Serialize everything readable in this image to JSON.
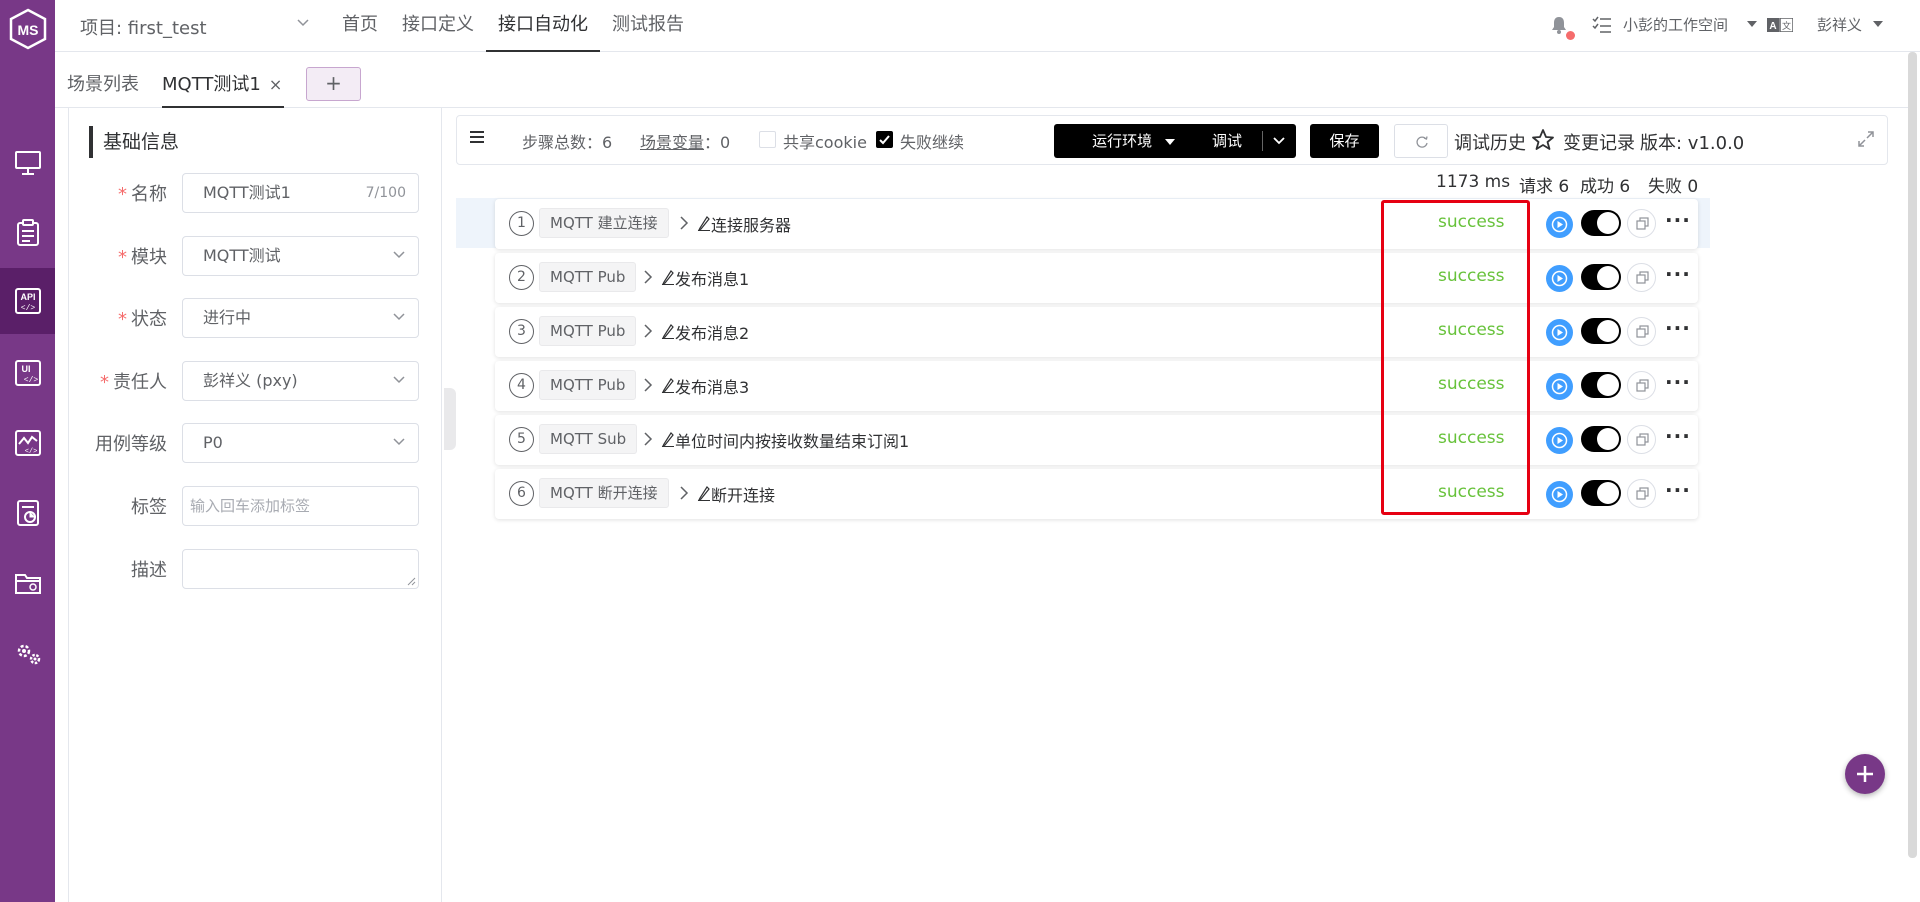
{
  "rail": {
    "logo_text": "MS",
    "items": [
      {
        "name": "workbench-icon",
        "active": false
      },
      {
        "name": "track-icon",
        "active": false
      },
      {
        "name": "api-icon",
        "active": true
      },
      {
        "name": "ui-icon",
        "active": false
      },
      {
        "name": "performance-icon",
        "active": false
      },
      {
        "name": "report-icon",
        "active": false
      },
      {
        "name": "project-icon",
        "active": false
      },
      {
        "name": "settings-icon",
        "active": false
      }
    ]
  },
  "header": {
    "project": "项目: first_test",
    "nav": [
      {
        "label": "首页",
        "active": false
      },
      {
        "label": "接口定义",
        "active": false
      },
      {
        "label": "接口自动化",
        "active": true
      },
      {
        "label": "测试报告",
        "active": false
      }
    ],
    "workspace": "小彭的工作空间",
    "user": "彭祥义"
  },
  "tabs": {
    "list_label": "场景列表",
    "active_label": "MQTT测试1",
    "close": "×",
    "add": "+"
  },
  "form": {
    "section_title": "基础信息",
    "required_mark": "*",
    "name_label": "名称",
    "name_value": "MQTT测试1",
    "name_count": "7/100",
    "module_label": "模块",
    "module_value": "MQTT测试",
    "status_label": "状态",
    "status_value": "进行中",
    "owner_label": "责任人",
    "owner_value": "彭祥义 (pxy)",
    "level_label": "用例等级",
    "level_value": "P0",
    "tags_label": "标签",
    "tags_placeholder": "输入回车添加标签",
    "desc_label": "描述"
  },
  "toolbar": {
    "steps_label": "步骤总数：",
    "steps_count": "6",
    "vars_label": "场景变量",
    "vars_sep": "：",
    "vars_count": "0",
    "share_cookie": "共享cookie",
    "share_cookie_checked": false,
    "fail_continue": "失败继续",
    "fail_continue_checked": true,
    "env_button": "运行环境",
    "debug_button": "调试",
    "save_button": "保存",
    "history": "调试历史",
    "changes": "变更记录",
    "version": "版本: v1.0.0"
  },
  "stats": {
    "duration": "1173 ms",
    "requests": "请求 6",
    "success": "成功 6",
    "fail": "失败 0"
  },
  "steps": [
    {
      "index": "1",
      "type": "MQTT 建立连接",
      "name": "连接服务器",
      "status": "success",
      "enabled": true
    },
    {
      "index": "2",
      "type": "MQTT Pub",
      "name": "发布消息1",
      "status": "success",
      "enabled": true
    },
    {
      "index": "3",
      "type": "MQTT Pub",
      "name": "发布消息2",
      "status": "success",
      "enabled": true
    },
    {
      "index": "4",
      "type": "MQTT Pub",
      "name": "发布消息3",
      "status": "success",
      "enabled": true
    },
    {
      "index": "5",
      "type": "MQTT Sub",
      "name": "单位时间内按接收数量结束订阅1",
      "status": "success",
      "enabled": true
    },
    {
      "index": "6",
      "type": "MQTT 断开连接",
      "name": "断开连接",
      "status": "success",
      "enabled": true
    }
  ],
  "colors": {
    "brand": "#783887",
    "success": "#67c23a",
    "highlight_box": "#e60012",
    "play": "#409eff"
  }
}
